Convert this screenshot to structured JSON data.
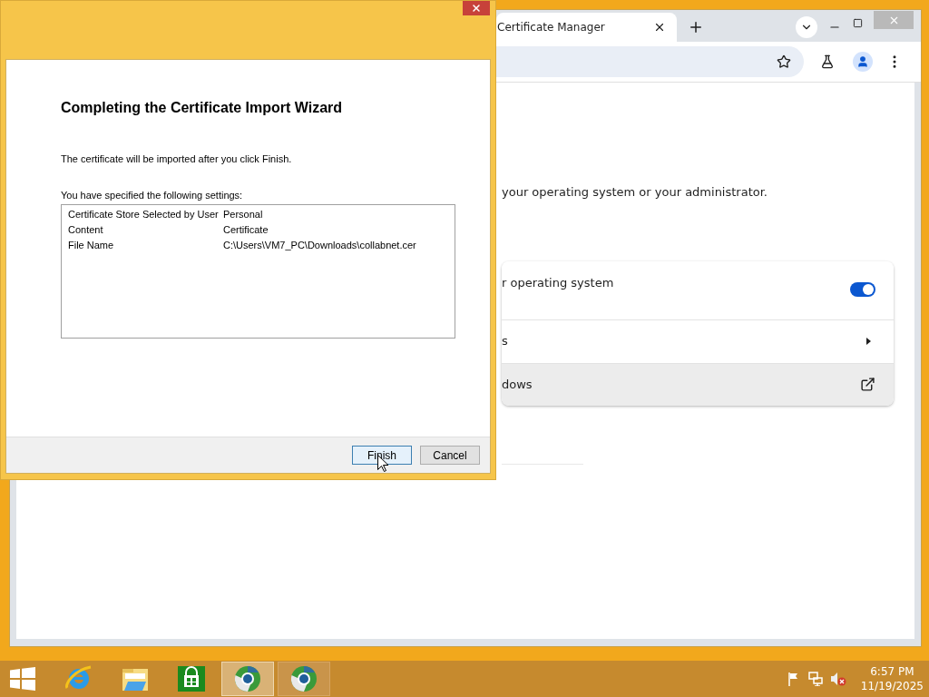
{
  "browser": {
    "tab": {
      "title": "Certificate Manager"
    },
    "description": "your operating system or your administrator.",
    "settings": [
      {
        "kind": "toggle",
        "label": "r operating system",
        "on": true,
        "hovered": false
      },
      {
        "kind": "submenu",
        "label": "s",
        "hovered": false
      },
      {
        "kind": "external",
        "label": "dows",
        "hovered": true
      }
    ]
  },
  "wizard": {
    "heading": "Completing the Certificate Import Wizard",
    "message": "The certificate will be imported after you click Finish.",
    "settings_label": "You have specified the following settings:",
    "settings": [
      {
        "name": "Certificate Store Selected by User",
        "value": "Personal"
      },
      {
        "name": "Content",
        "value": "Certificate"
      },
      {
        "name": "File Name",
        "value": "C:\\Users\\VM7_PC\\Downloads\\collabnet.cer"
      }
    ],
    "buttons": [
      {
        "label": "Finish",
        "focused": true
      },
      {
        "label": "Cancel",
        "focused": false
      }
    ]
  },
  "taskbar": {
    "items": [
      {
        "kind": "start",
        "selected": false
      },
      {
        "kind": "ie",
        "selected": false
      },
      {
        "kind": "explorer",
        "selected": false
      },
      {
        "kind": "store",
        "selected": false
      },
      {
        "kind": "chrome",
        "selected": true
      },
      {
        "kind": "chrome",
        "selected": false
      }
    ],
    "time": "6:57 PM",
    "date": "11/19/2025"
  }
}
